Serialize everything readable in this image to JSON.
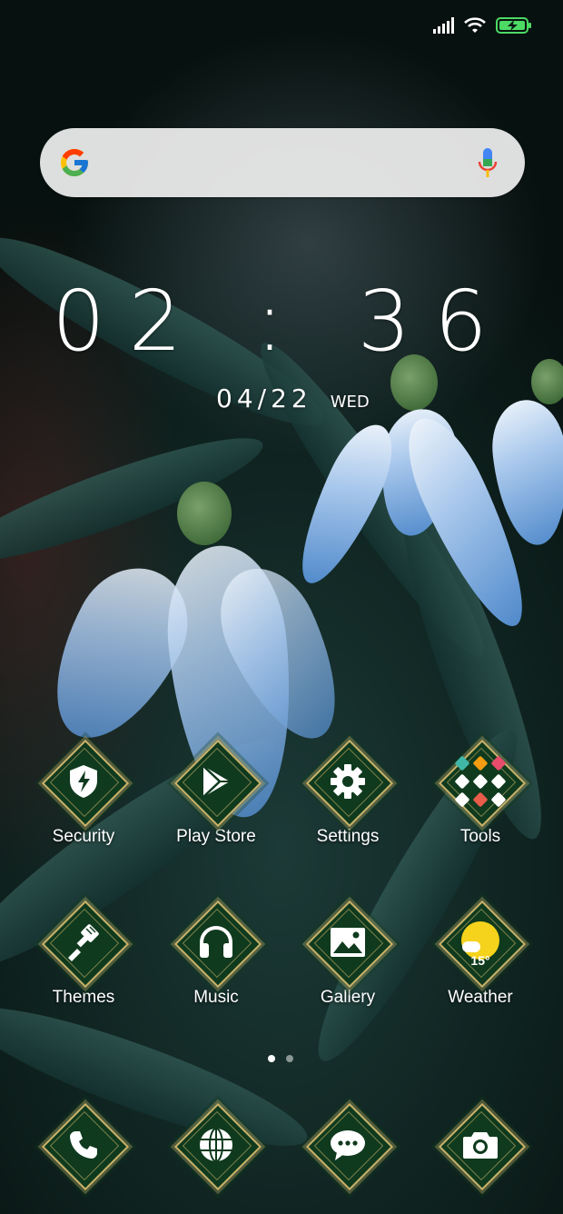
{
  "status_bar": {
    "signal_icon": "signal-bars-icon",
    "wifi_icon": "wifi-icon",
    "battery_icon": "battery-charging-icon",
    "battery_color": "#4cd964"
  },
  "search": {
    "logo": "google-g-icon",
    "mic": "microphone-icon",
    "placeholder": ""
  },
  "clock": {
    "time": "02 : 36",
    "date": "04/22",
    "weekday": "WED"
  },
  "apps": [
    {
      "label": "Security",
      "icon": "shield-bolt-icon"
    },
    {
      "label": "Play Store",
      "icon": "play-store-icon"
    },
    {
      "label": "Settings",
      "icon": "gear-icon"
    },
    {
      "label": "Tools",
      "icon": "tools-folder-icon"
    },
    {
      "label": "Themes",
      "icon": "paintbrush-icon"
    },
    {
      "label": "Music",
      "icon": "headphones-icon"
    },
    {
      "label": "Gallery",
      "icon": "picture-icon"
    },
    {
      "label": "Weather",
      "icon": "weather-sun-icon",
      "temperature": "15°"
    }
  ],
  "pager": {
    "pages": 2,
    "active": 1
  },
  "dock": [
    {
      "icon": "phone-icon"
    },
    {
      "icon": "globe-icon"
    },
    {
      "icon": "chat-bubble-icon"
    },
    {
      "icon": "camera-icon"
    }
  ],
  "colors": {
    "icon_background": "#0f3a1e",
    "icon_border": "#c9b26a"
  }
}
